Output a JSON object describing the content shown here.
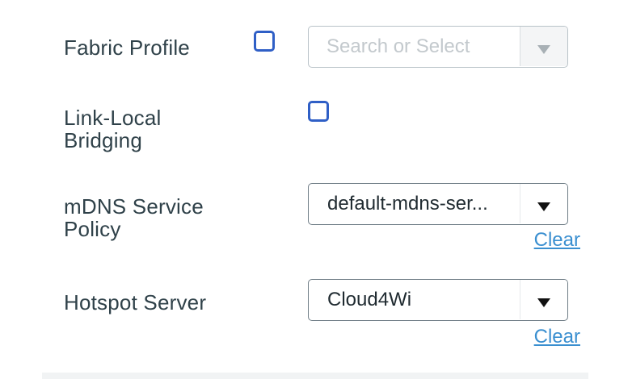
{
  "form": {
    "fabric_profile": {
      "label": "Fabric Profile",
      "checked": false,
      "placeholder": "Search or Select"
    },
    "link_local_bridging": {
      "label_line1": "Link-Local",
      "label_line2": "Bridging",
      "checked": false
    },
    "mdns_service_policy": {
      "label_line1": "mDNS Service",
      "label_line2": "Policy",
      "value": "default-mdns-ser...",
      "clear_label": "Clear"
    },
    "hotspot_server": {
      "label": "Hotspot Server",
      "value": "Cloud4Wi",
      "clear_label": "Clear"
    }
  },
  "colors": {
    "label_text": "#2f4149",
    "checkbox_border": "#2f5fc6",
    "link": "#3a8fd0",
    "placeholder": "#c3c9cd"
  },
  "icons": {
    "dropdown": "caret-down-icon"
  }
}
